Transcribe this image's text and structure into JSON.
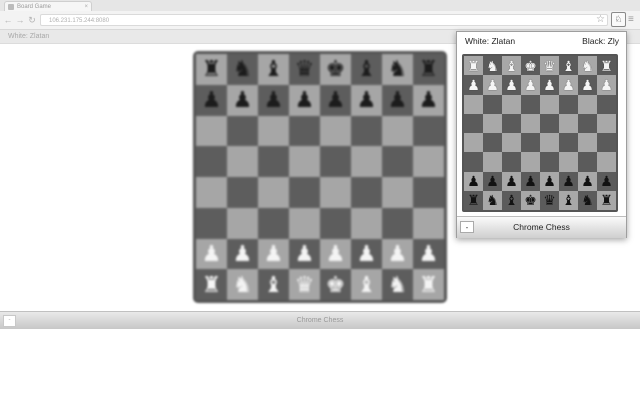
{
  "browser": {
    "tab_title": "Board Game",
    "tab_close": "×",
    "back": "←",
    "forward": "→",
    "reload": "↻",
    "url": "106.231.175.244:8080",
    "star": "☆",
    "extension_icon": "♘",
    "menu": "≡"
  },
  "page": {
    "header_text": "White: Zlatan",
    "footer_title": "Chrome Chess",
    "footer_min": "-"
  },
  "popup": {
    "white_player": "White: Zlatan",
    "black_player": "Black: Zly",
    "footer_title": "Chrome Chess",
    "min_button": "-"
  },
  "boards": {
    "background_board": [
      [
        "♜",
        "♞",
        "♝",
        "♛",
        "♚",
        "♝",
        "♞",
        "♜"
      ],
      [
        "♟",
        "♟",
        "♟",
        "♟",
        "♟",
        "♟",
        "♟",
        "♟"
      ],
      [
        "",
        "",
        "",
        "",
        "",
        "",
        "",
        ""
      ],
      [
        "",
        "",
        "",
        "",
        "",
        "",
        "",
        ""
      ],
      [
        "",
        "",
        "",
        "",
        "",
        "",
        "",
        ""
      ],
      [
        "",
        "",
        "",
        "",
        "",
        "",
        "",
        ""
      ],
      [
        "♟",
        "♟",
        "♟",
        "♟",
        "♟",
        "♟",
        "♟",
        "♟"
      ],
      [
        "♜",
        "♞",
        "♝",
        "♛",
        "♚",
        "♝",
        "♞",
        "♜"
      ]
    ],
    "background_colors": [
      [
        "b",
        "b",
        "b",
        "b",
        "b",
        "b",
        "b",
        "b"
      ],
      [
        "b",
        "b",
        "b",
        "b",
        "b",
        "b",
        "b",
        "b"
      ],
      [
        "",
        "",
        "",
        "",
        "",
        "",
        "",
        ""
      ],
      [
        "",
        "",
        "",
        "",
        "",
        "",
        "",
        ""
      ],
      [
        "",
        "",
        "",
        "",
        "",
        "",
        "",
        ""
      ],
      [
        "",
        "",
        "",
        "",
        "",
        "",
        "",
        ""
      ],
      [
        "w",
        "w",
        "w",
        "w",
        "w",
        "w",
        "w",
        "w"
      ],
      [
        "w",
        "w",
        "w",
        "w",
        "w",
        "w",
        "w",
        "w"
      ]
    ],
    "popup_board": [
      [
        "♜",
        "♞",
        "♝",
        "♚",
        "♛",
        "♝",
        "♞",
        "♜"
      ],
      [
        "♟",
        "♟",
        "♟",
        "♟",
        "♟",
        "♟",
        "♟",
        "♟"
      ],
      [
        "",
        "",
        "",
        "",
        "",
        "",
        "",
        ""
      ],
      [
        "",
        "",
        "",
        "",
        "",
        "",
        "",
        ""
      ],
      [
        "",
        "",
        "",
        "",
        "",
        "",
        "",
        ""
      ],
      [
        "",
        "",
        "",
        "",
        "",
        "",
        "",
        ""
      ],
      [
        "♟",
        "♟",
        "♟",
        "♟",
        "♟",
        "♟",
        "♟",
        "♟"
      ],
      [
        "♜",
        "♞",
        "♝",
        "♚",
        "♛",
        "♝",
        "♞",
        "♜"
      ]
    ],
    "popup_colors": [
      [
        "w",
        "w",
        "w",
        "w",
        "w",
        "w",
        "w",
        "w"
      ],
      [
        "w",
        "w",
        "w",
        "w",
        "w",
        "w",
        "w",
        "w"
      ],
      [
        "",
        "",
        "",
        "",
        "",
        "",
        "",
        ""
      ],
      [
        "",
        "",
        "",
        "",
        "",
        "",
        "",
        ""
      ],
      [
        "",
        "",
        "",
        "",
        "",
        "",
        "",
        ""
      ],
      [
        "",
        "",
        "",
        "",
        "",
        "",
        "",
        ""
      ],
      [
        "b",
        "b",
        "b",
        "b",
        "b",
        "b",
        "b",
        "b"
      ],
      [
        "b",
        "b",
        "b",
        "b",
        "b",
        "b",
        "b",
        "b"
      ]
    ]
  }
}
